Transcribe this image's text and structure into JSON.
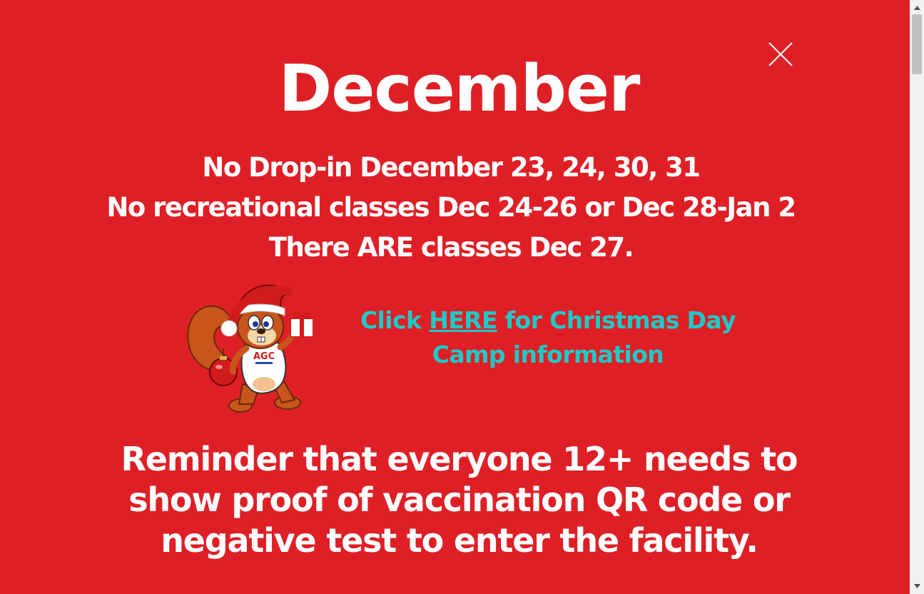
{
  "colors": {
    "background": "#df1f26",
    "primary_text": "#ffffff",
    "accent_text": "#1fc8c6",
    "scrollbar_track": "#f1f1f1",
    "scrollbar_thumb": "#c1c1c1"
  },
  "popup": {
    "close_icon": "close-icon",
    "title": "December",
    "notices": [
      "No Drop-in December 23, 24, 30, 31",
      "No recreational classes Dec 24-26 or Dec 28-Jan 2",
      "There ARE classes Dec 27."
    ],
    "mascot": {
      "icon": "squirrel-santa-mascot",
      "shirt_text": "AGC"
    },
    "camp": {
      "prefix": "Click ",
      "link_label": "HERE",
      "suffix_line1": " for Christmas Day",
      "line2": "Camp information"
    },
    "reminder": [
      "Reminder that everyone 12+ needs to",
      "show proof of vaccination QR code or",
      "negative test to enter the facility."
    ]
  },
  "scrollbar": {
    "up_icon": "scroll-up-arrow-icon",
    "down_icon": "scroll-down-arrow-icon"
  }
}
